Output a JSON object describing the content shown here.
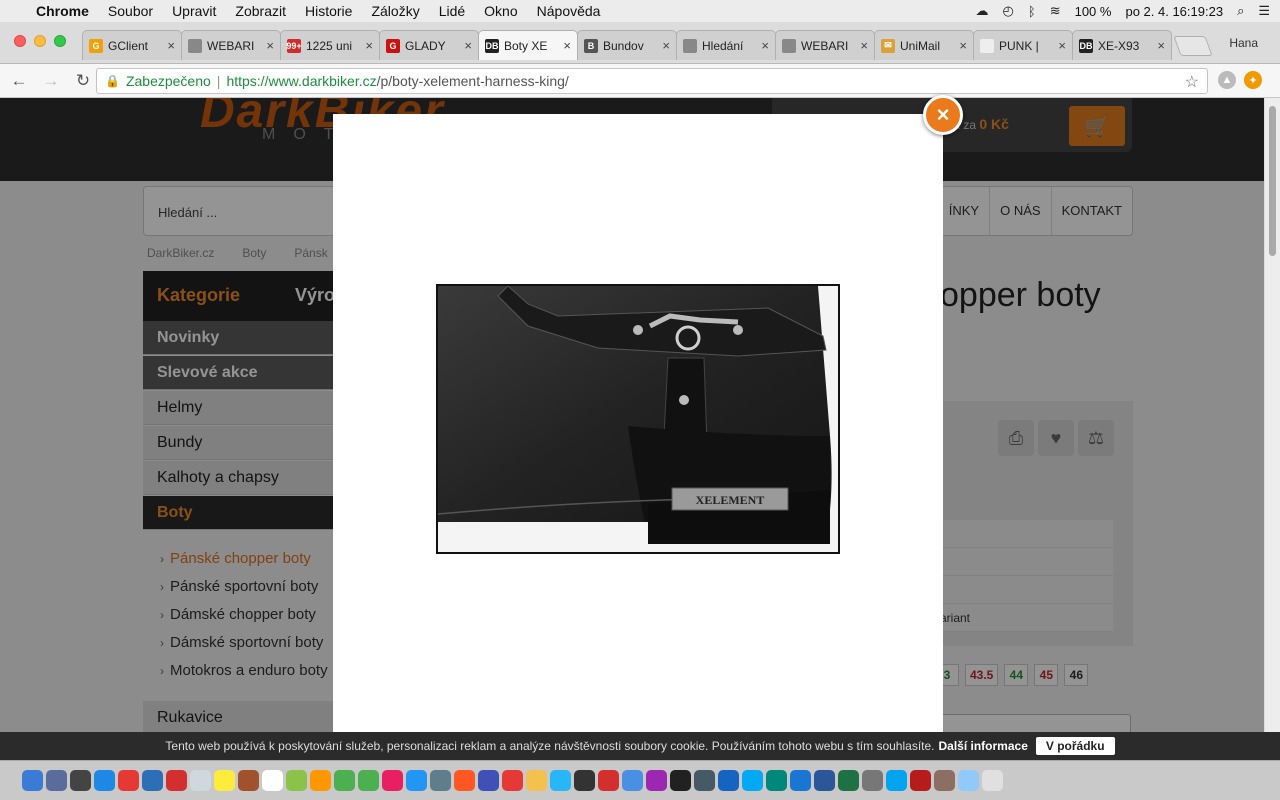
{
  "menubar": {
    "app": "Chrome",
    "items": [
      "Soubor",
      "Upravit",
      "Zobrazit",
      "Historie",
      "Záložky",
      "Lidé",
      "Okno",
      "Nápověda"
    ],
    "battery": "100 %",
    "clock": "po 2. 4.  16:19:23"
  },
  "tabs": [
    {
      "title": "GClient",
      "fav": "#f2a007",
      "glyph": "G"
    },
    {
      "title": "WEBARI",
      "fav": "#888",
      "glyph": ""
    },
    {
      "title": "1225 uni",
      "fav": "#d42a2a",
      "glyph": "99+"
    },
    {
      "title": "GLADY",
      "fav": "#c11",
      "glyph": "G"
    },
    {
      "title": "Boty XE",
      "fav": "#222",
      "glyph": "DB"
    },
    {
      "title": "Bundov",
      "fav": "#555",
      "glyph": "B"
    },
    {
      "title": "Hledání",
      "fav": "#888",
      "glyph": ""
    },
    {
      "title": "WEBARI",
      "fav": "#888",
      "glyph": ""
    },
    {
      "title": "UniMail",
      "fav": "#d9a13a",
      "glyph": "✉"
    },
    {
      "title": "PUNK |",
      "fav": "#eee",
      "glyph": ""
    },
    {
      "title": "XE-X93",
      "fav": "#222",
      "glyph": "DB"
    }
  ],
  "profile": "Hana",
  "address": {
    "secure_label": "Zabezpečeno",
    "url_host": "https://www.darkbiker.cz",
    "url_path": "/p/boty-xelement-harness-king/"
  },
  "site": {
    "logo": "DarkBiker",
    "logo_sub": "MOTO",
    "cart_label": "k za",
    "cart_price": "0 Kč",
    "search_placeholder": "Hledání ...",
    "nav": [
      "ÍNKY",
      "O NÁS",
      "KONTAKT"
    ],
    "breadcrumbs": [
      "DarkBiker.cz",
      "Boty",
      "Pánsk"
    ],
    "sidebar_head": "Kategorie",
    "sidebar_head2": "Výrob",
    "sidebar": [
      {
        "label": "Novinky",
        "style": "dark"
      },
      {
        "label": "Slevové akce",
        "style": "dark"
      },
      {
        "label": "Helmy",
        "style": "light"
      },
      {
        "label": "Bundy",
        "style": "light"
      },
      {
        "label": "Kalhoty a chapsy",
        "style": "light"
      },
      {
        "label": "Boty",
        "style": "black"
      }
    ],
    "subcats": [
      {
        "label": "Pánské chopper boty",
        "active": true
      },
      {
        "label": "Pánské sportovní boty",
        "active": false
      },
      {
        "label": "Dámské chopper boty",
        "active": false
      },
      {
        "label": "Dámské sportovní boty",
        "active": false
      },
      {
        "label": "Motokros a enduro boty",
        "active": false
      }
    ],
    "sidebar_after": "Rukavice",
    "title_fragment": "opper boty",
    "variant_label": "ariant",
    "sizes": [
      {
        "label": "3",
        "color": "g"
      },
      {
        "label": "43.5",
        "color": "r"
      },
      {
        "label": "44",
        "color": "g"
      },
      {
        "label": "45",
        "color": "r"
      },
      {
        "label": "46",
        "color": "k"
      }
    ]
  },
  "modal": {
    "close": "×",
    "brand_plate": "XELEMENT"
  },
  "cookie": {
    "text": "Tento web používá k poskytování služeb, personalizaci reklam a analýze návštěvnosti soubory cookie. Používáním tohoto webu s tím souhlasíte.",
    "more": "Další informace",
    "ok": "V pořádku"
  },
  "dock_colors": [
    "#3a7bd5",
    "#5a6c9c",
    "#444",
    "#1e88e5",
    "#e53935",
    "#2c6fb7",
    "#d32f2f",
    "#cfd8dc",
    "#ffeb3b",
    "#a0522d",
    "#fff",
    "#8bc34a",
    "#ff9800",
    "#4caf50",
    "#4caf50",
    "#e91e63",
    "#2196f3",
    "#607d8b",
    "#ff5722",
    "#3f51b5",
    "#e53935",
    "#f2c14e",
    "#29b6f6",
    "#333",
    "#d32f2f",
    "#4a90e2",
    "#9c27b0",
    "#212121",
    "#455a64",
    "#1565c0",
    "#03a9f4",
    "#00897b",
    "#1976d2",
    "#2b579a",
    "#1e7145",
    "#777",
    "#00a4ef",
    "#b71c1c",
    "#8d6e63",
    "#90caf9",
    "#e0e0e0"
  ]
}
